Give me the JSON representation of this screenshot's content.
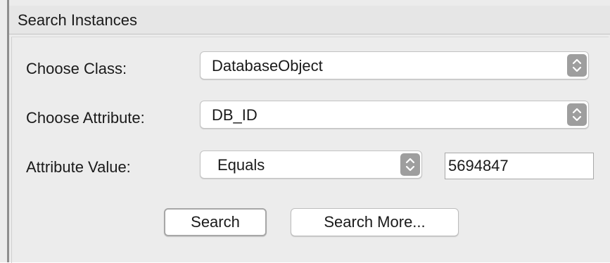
{
  "panel": {
    "title": "Search Instances"
  },
  "form": {
    "class_label": "Choose Class:",
    "class_value": "DatabaseObject",
    "attribute_label": "Choose Attribute:",
    "attribute_value": "DB_ID",
    "value_label": "Attribute Value:",
    "operator_value": "Equals",
    "value_text": "5694847"
  },
  "buttons": {
    "search_label": "Search",
    "search_more_label": "Search More..."
  },
  "icons": {
    "stepper": "up-down-chevron-icon"
  }
}
